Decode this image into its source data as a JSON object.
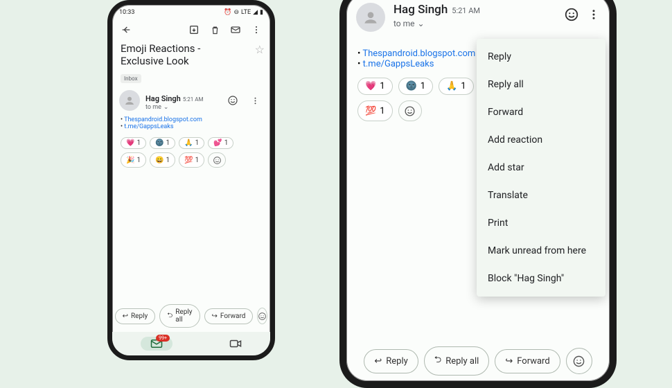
{
  "phone1": {
    "status": {
      "time": "10:33",
      "net": "LTE"
    },
    "subject": "Emoji Reactions - Exclusive Look",
    "label": "Inbox",
    "sender": "Hag Singh",
    "timestamp": "5:21 AM",
    "to": "to me",
    "links": [
      "Thespandroid.blogspot.com",
      "t.me/GappsLeaks"
    ],
    "reactions": [
      {
        "emoji": "💗",
        "count": "1"
      },
      {
        "emoji": "🌚",
        "count": "1"
      },
      {
        "emoji": "🙏",
        "count": "1"
      },
      {
        "emoji": "💕",
        "count": "1"
      },
      {
        "emoji": "🎉",
        "count": "1"
      },
      {
        "emoji": "😄",
        "count": "1"
      },
      {
        "emoji": "💯",
        "count": "1"
      }
    ],
    "actions": {
      "reply": "Reply",
      "replyall": "Reply all",
      "forward": "Forward"
    },
    "badge": "99+"
  },
  "phone2": {
    "sender": "Hag Singh",
    "timestamp": "5:21 AM",
    "to": "to me",
    "links": [
      "Thespandroid.blogspot.com",
      "t.me/GappsLeaks"
    ],
    "reactions": [
      {
        "emoji": "💗",
        "count": "1"
      },
      {
        "emoji": "🌚",
        "count": "1"
      },
      {
        "emoji": "🙏",
        "count": "1"
      },
      {
        "emoji": "💯",
        "count": "1"
      }
    ],
    "menu": [
      "Reply",
      "Reply all",
      "Forward",
      "Add reaction",
      "Add star",
      "Translate",
      "Print",
      "Mark unread from here",
      "Block \"Hag Singh\""
    ],
    "actions": {
      "reply": "Reply",
      "replyall": "Reply all",
      "forward": "Forward"
    }
  }
}
